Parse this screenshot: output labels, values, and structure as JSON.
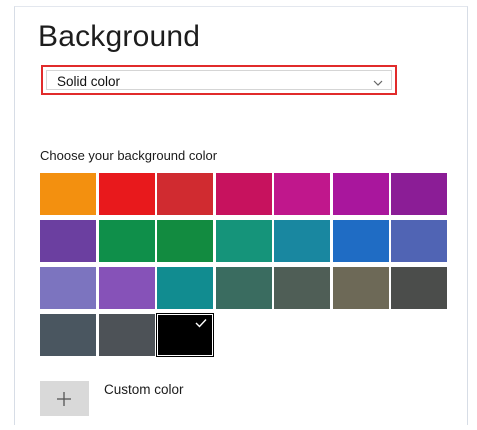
{
  "header": {
    "title": "Background"
  },
  "background_dropdown": {
    "selected": "Solid color"
  },
  "color_picker": {
    "label": "Choose your background color",
    "selected_index": 23,
    "colors": [
      "#f3900f",
      "#e8191c",
      "#d02b30",
      "#c7125e",
      "#c0178c",
      "#a9169d",
      "#8b1d96",
      "#6b3fa0",
      "#0f8f4a",
      "#128b40",
      "#15947a",
      "#1987a0",
      "#1f6cc4",
      "#5064b4",
      "#7c74bf",
      "#8652b8",
      "#118c90",
      "#3a6c60",
      "#4f5e56",
      "#6d6957",
      "#4b4d4b",
      "#4a5660",
      "#4d5257",
      "#000000"
    ]
  },
  "custom_color": {
    "label": "Custom color"
  }
}
